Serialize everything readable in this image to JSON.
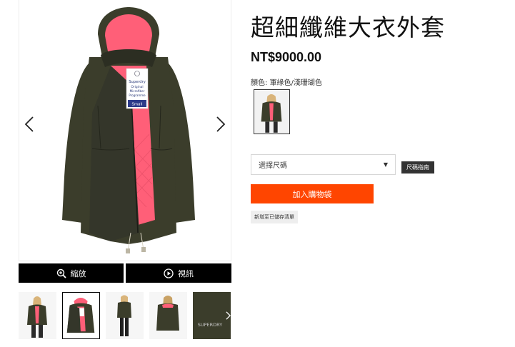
{
  "product": {
    "title": "超細纖維大衣外套",
    "price": "NT$9000.00",
    "color_label": "顏色:",
    "color_value": "軍綠色/淺珊瑚色"
  },
  "gallery": {
    "zoom_label": "縮放",
    "video_label": "視訊",
    "tag_lines": [
      "Superdry",
      "Original",
      "Microfiber",
      "Programme"
    ],
    "size_tag": "Small",
    "thumbnail_brand_text": "SUPERDRY",
    "colors": {
      "jacket": "#3b3d2b",
      "jacket_dark": "#23251a",
      "lining": "#ff5f78"
    }
  },
  "purchase": {
    "size_placeholder": "選擇尺碼",
    "size_guide": "尺碼指南",
    "add_to_cart": "加入購物袋",
    "wishlist": "新增至已儲存清單",
    "cart_color": "#ff4500"
  }
}
